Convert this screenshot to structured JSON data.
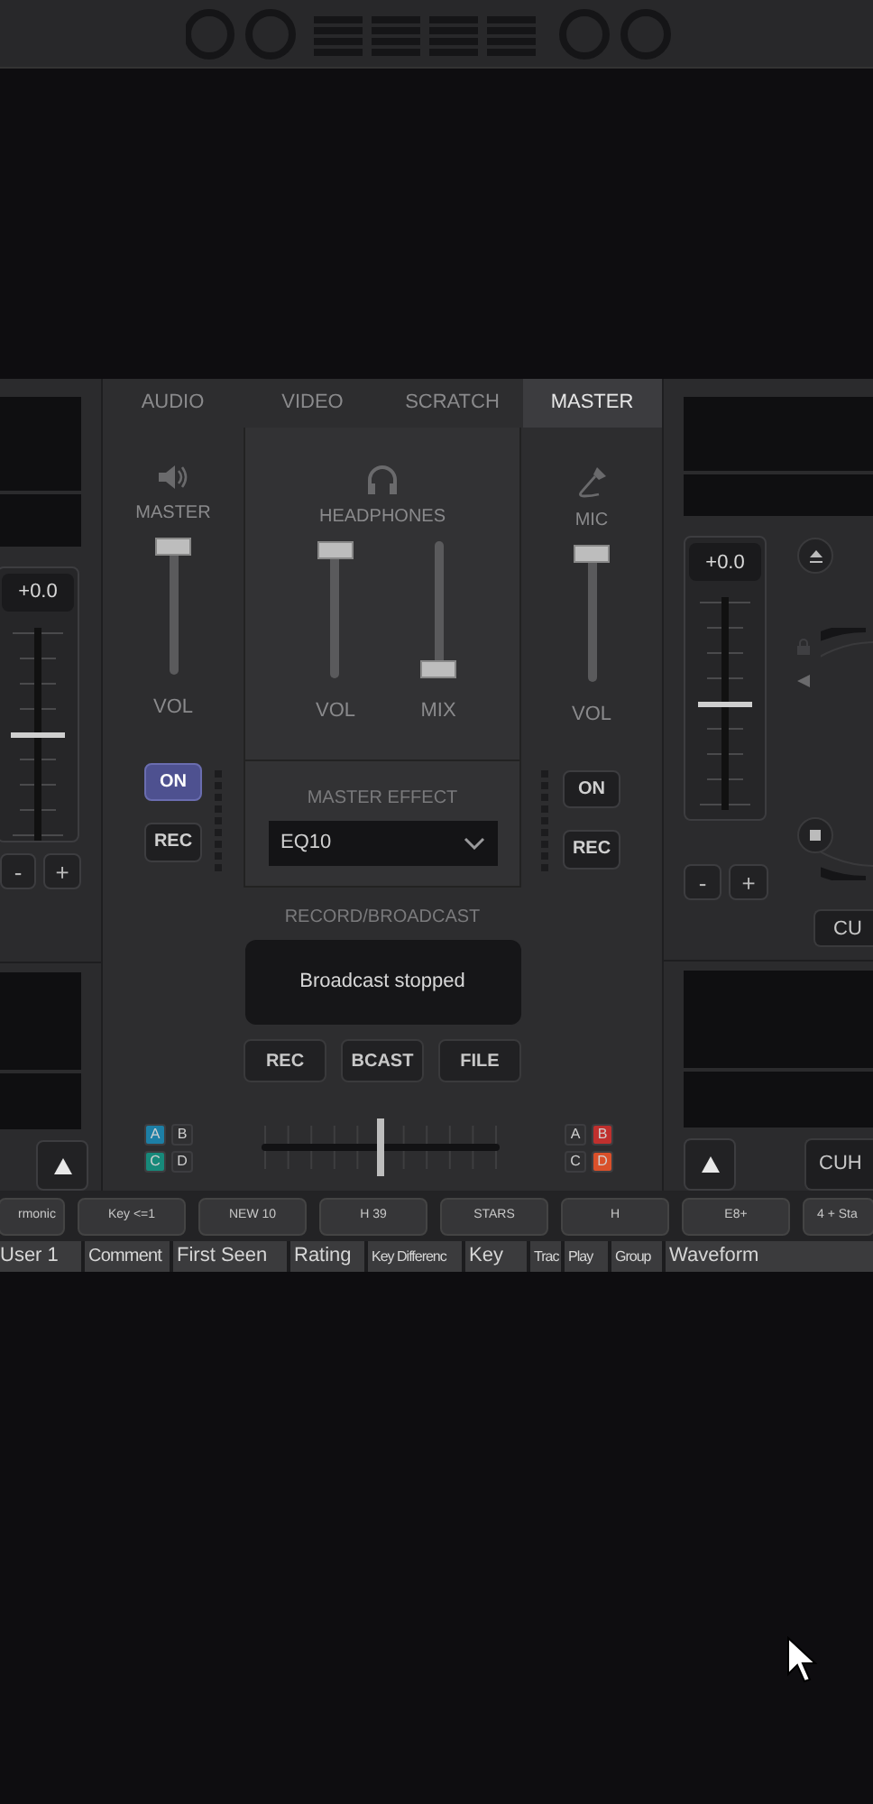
{
  "left_deck": {
    "pitch": {
      "reading": "+0.0",
      "level": 0.5
    },
    "minus": "-",
    "plus": "+"
  },
  "mixer": {
    "tabs": [
      {
        "label": "AUDIO",
        "selected": false
      },
      {
        "label": "VIDEO",
        "selected": false
      },
      {
        "label": "SCRATCH",
        "selected": false
      },
      {
        "label": "MASTER",
        "selected": true
      }
    ],
    "master": {
      "label": "MASTER",
      "level": 1,
      "slider_label": "VOL",
      "on": {
        "label": "ON",
        "selected": true
      },
      "rec": "REC"
    },
    "headphones": {
      "label": "HEADPHONES",
      "sliders": [
        {
          "label": "VOL",
          "level": 1
        },
        {
          "label": "MIX",
          "level": 0
        }
      ]
    },
    "master_effect": {
      "label": "MASTER EFFECT",
      "value": "EQ10"
    },
    "mic": {
      "label": "MIC",
      "level": 1,
      "slider_label": "VOL",
      "on": {
        "label": "ON",
        "selected": false
      },
      "rec": "REC"
    },
    "record_broadcast": {
      "label": "RECORD/BROADCAST",
      "status": "Broadcast stopped",
      "buttons": [
        "REC",
        "BCAST",
        "FILE"
      ]
    },
    "left_deck_select": [
      {
        "label": "A",
        "color": "#1d7fa6"
      },
      {
        "label": "B",
        "color": "#2f2f31"
      },
      {
        "label": "C",
        "color": "#17897a"
      },
      {
        "label": "D",
        "color": "#2f2f31"
      }
    ],
    "crossfader": {
      "level": 0.5
    },
    "right_deck_select": [
      {
        "label": "A",
        "color": "#2f2f31"
      },
      {
        "label": "B",
        "color": "#c0302e"
      },
      {
        "label": "C",
        "color": "#2f2f31"
      },
      {
        "label": "D",
        "color": "#d9502a"
      }
    ]
  },
  "right_deck": {
    "pitch": {
      "reading": "+0.0",
      "level": 0.5
    },
    "minus": "-",
    "plus": "+",
    "cue": "CU",
    "cue_bottom": "CUH"
  },
  "filters": [
    "rmonic",
    "Key <=1",
    "NEW 10",
    "H 39",
    "STARS",
    "H",
    "E8+",
    "4 + Sta"
  ],
  "columns": [
    "User 1",
    "Comment",
    "First Seen",
    "Rating",
    "Key Differenc",
    "Key",
    "Trac",
    "Play",
    "Group",
    "Waveform"
  ]
}
